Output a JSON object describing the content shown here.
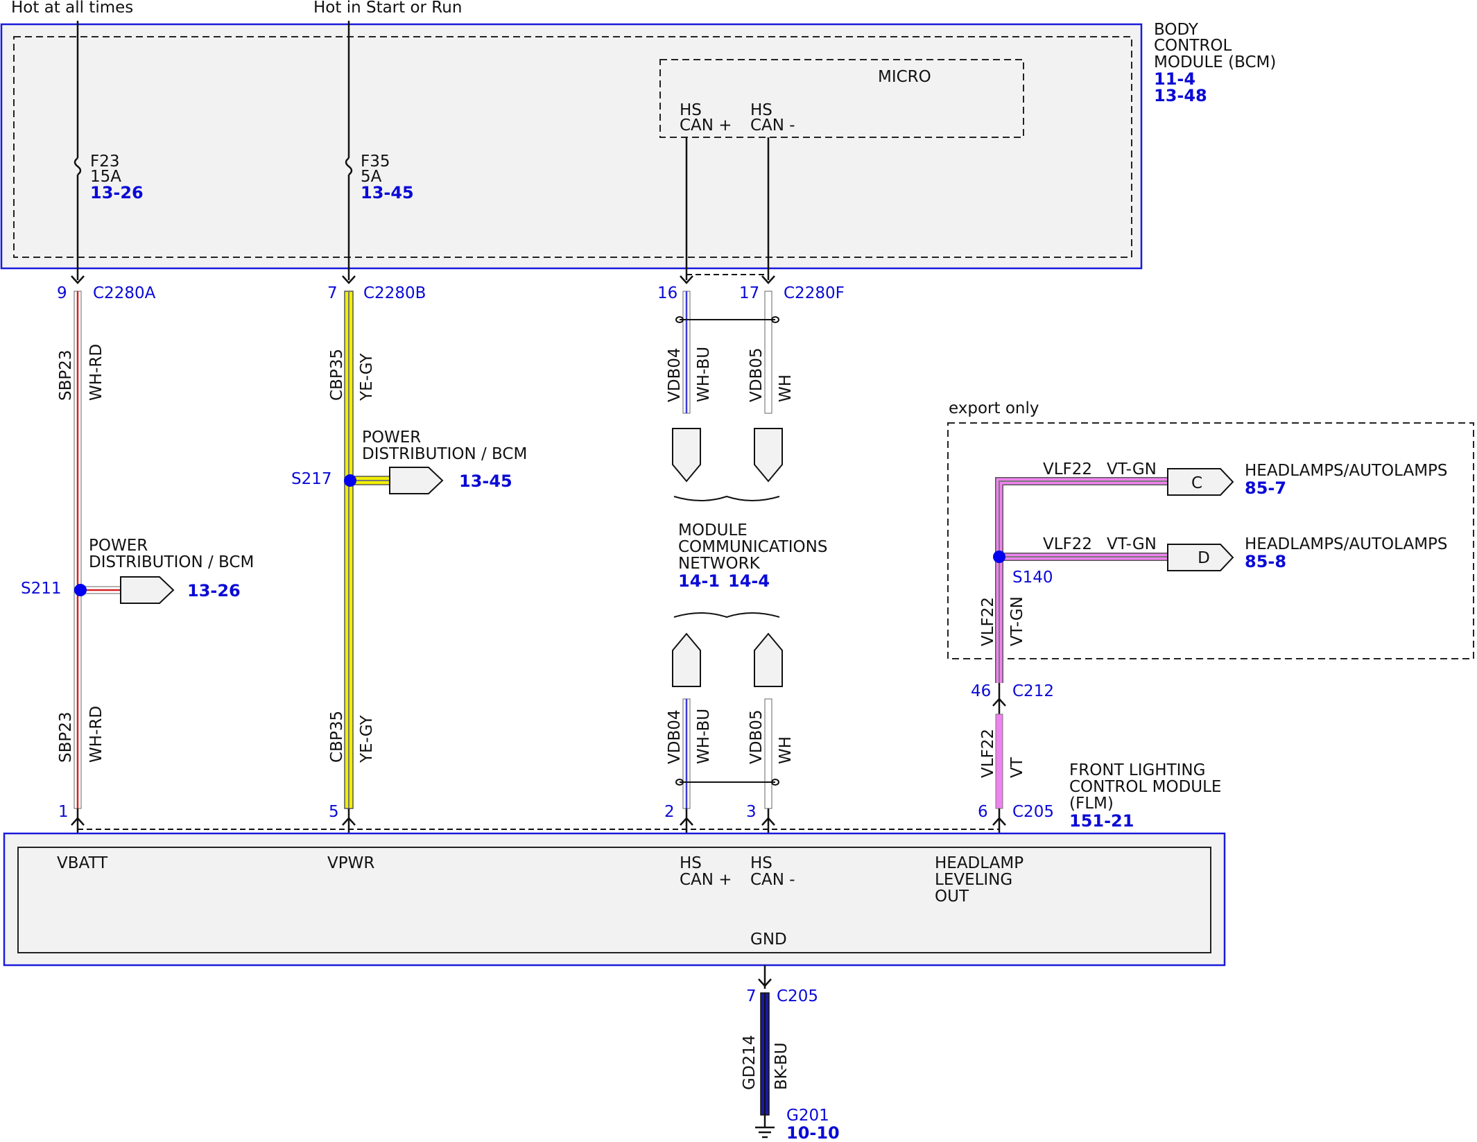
{
  "supply": {
    "hot_all_times": "Hot at all times",
    "hot_start_run": "Hot in Start or Run"
  },
  "bcm": {
    "name_l1": "BODY",
    "name_l2": "CONTROL",
    "name_l3": "MODULE (BCM)",
    "ref1": "11-4",
    "ref2": "13-48",
    "micro": "MICRO",
    "hs_can_plus_l1": "HS",
    "hs_can_plus_l2": "CAN +",
    "hs_can_minus_l1": "HS",
    "hs_can_minus_l2": "CAN -"
  },
  "fuses": [
    {
      "name": "F23",
      "rating": "15A",
      "ref": "13-26"
    },
    {
      "name": "F35",
      "rating": "5A",
      "ref": "13-45"
    }
  ],
  "connectors": {
    "c2280a": {
      "name": "C2280A",
      "pin": "9"
    },
    "c2280b": {
      "name": "C2280B",
      "pin": "7"
    },
    "c2280f": {
      "name": "C2280F",
      "pin_a": "16",
      "pin_b": "17"
    },
    "c212": {
      "name": "C212",
      "pin": "46"
    },
    "c205_top": {
      "name": "C205",
      "pins": [
        "1",
        "5",
        "2",
        "3",
        "6"
      ]
    },
    "c205_gnd": {
      "name": "C205",
      "pin": "7"
    }
  },
  "wires": {
    "sbp23": {
      "circuit": "SBP23",
      "color": "WH-RD"
    },
    "cbp35": {
      "circuit": "CBP35",
      "color": "YE-GY"
    },
    "vdb04": {
      "circuit": "VDB04",
      "color": "WH-BU"
    },
    "vdb05": {
      "circuit": "VDB05",
      "color": "WH"
    },
    "vlf22_a": {
      "circuit": "VLF22",
      "color": "VT-GN"
    },
    "vlf22_b": {
      "circuit": "VLF22",
      "color": "VT"
    },
    "gd214": {
      "circuit": "GD214",
      "color": "BK-BU"
    }
  },
  "splices": {
    "s211": {
      "name": "S211",
      "dest_l1": "POWER",
      "dest_l2": "DISTRIBUTION / BCM",
      "ref": "13-26"
    },
    "s217": {
      "name": "S217",
      "dest_l1": "POWER",
      "dest_l2": "DISTRIBUTION / BCM",
      "ref": "13-45"
    },
    "s140": {
      "name": "S140"
    }
  },
  "network": {
    "l1": "MODULE",
    "l2": "COMMUNICATIONS",
    "l3": "NETWORK",
    "ref1": "14-1",
    "ref2": "14-4"
  },
  "export": {
    "label": "export only",
    "c": {
      "letter": "C",
      "dest": "HEADLAMPS/AUTOLAMPS",
      "ref": "85-7"
    },
    "d": {
      "letter": "D",
      "dest": "HEADLAMPS/AUTOLAMPS",
      "ref": "85-8"
    }
  },
  "flm": {
    "name_l1": "FRONT LIGHTING",
    "name_l2": "CONTROL MODULE",
    "name_l3": "(FLM)",
    "ref": "151-21",
    "vbatt": "VBATT",
    "vpwr": "VPWR",
    "hs_plus_l1": "HS",
    "hs_plus_l2": "CAN +",
    "hs_minus_l1": "HS",
    "hs_minus_l2": "CAN -",
    "hl_l1": "HEADLAMP",
    "hl_l2": "LEVELING",
    "hl_l3": "OUT",
    "gnd": "GND"
  },
  "ground": {
    "name": "G201",
    "ref": "10-10"
  },
  "colors": {
    "module_outline": "#1a1adc",
    "pin_blue": "#0a0ad6",
    "splice_dot": "#0000ee",
    "wire_red": "#d42020",
    "wire_yellow": "#f0f000",
    "wire_blue": "#3a3adc",
    "wire_violet": "#ee82ee",
    "wire_green": "#7a7a7a",
    "wire_dark": "#1a1a9e"
  }
}
